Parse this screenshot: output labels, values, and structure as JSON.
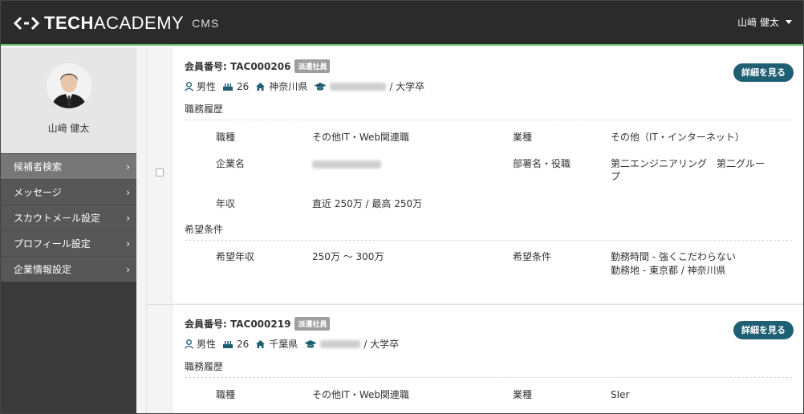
{
  "header": {
    "logo_tech": "TECH",
    "logo_academy": "ACADEMY",
    "logo_cms": "CMS",
    "user_name": "山﨑 健太"
  },
  "sidebar": {
    "profile_name": "山﨑 健太",
    "items": [
      {
        "label": "候補者検索"
      },
      {
        "label": "メッセージ"
      },
      {
        "label": "スカウトメール設定"
      },
      {
        "label": "プロフィール設定"
      },
      {
        "label": "企業情報設定"
      }
    ]
  },
  "colors": {
    "accent": "#1f5f73",
    "header_bg": "#2b2b2b",
    "header_border": "#69c36f",
    "sidebar_bg": "#575757",
    "sidebar_active": "#777777"
  },
  "cards": [
    {
      "member_label": "会員番号: TAC000206",
      "badge": "派遣社員",
      "detail_button": "詳細を見る",
      "gender": "男性",
      "age": "26",
      "location": "神奈川県",
      "education": "/ 大学卒",
      "career_title": "職務履歴",
      "job_type_label": "職種",
      "job_type_value": "その他IT・Web関連職",
      "industry_label": "業種",
      "industry_value": "その他（IT・インターネット）",
      "company_label": "企業名",
      "dept_label": "部署名・役職",
      "dept_value": "第二エンジニアリング　第二グループ",
      "income_label": "年収",
      "income_value": "直近 250万 / 最高 250万",
      "wish_title": "希望条件",
      "wish_income_label": "希望年収",
      "wish_income_value": "250万 〜 300万",
      "wish_cond_label": "希望条件",
      "wish_cond_line1": "勤務時間 - 強くこだわらない",
      "wish_cond_line2": "勤務地 - 東京都 / 神奈川県"
    },
    {
      "member_label": "会員番号: TAC000219",
      "badge": "派遣社員",
      "detail_button": "詳細を見る",
      "gender": "男性",
      "age": "26",
      "location": "千葉県",
      "education": "/ 大学卒",
      "career_title": "職務履歴",
      "job_type_label": "職種",
      "job_type_value": "その他IT・Web関連職",
      "industry_label": "業種",
      "industry_value": "SIer"
    }
  ]
}
